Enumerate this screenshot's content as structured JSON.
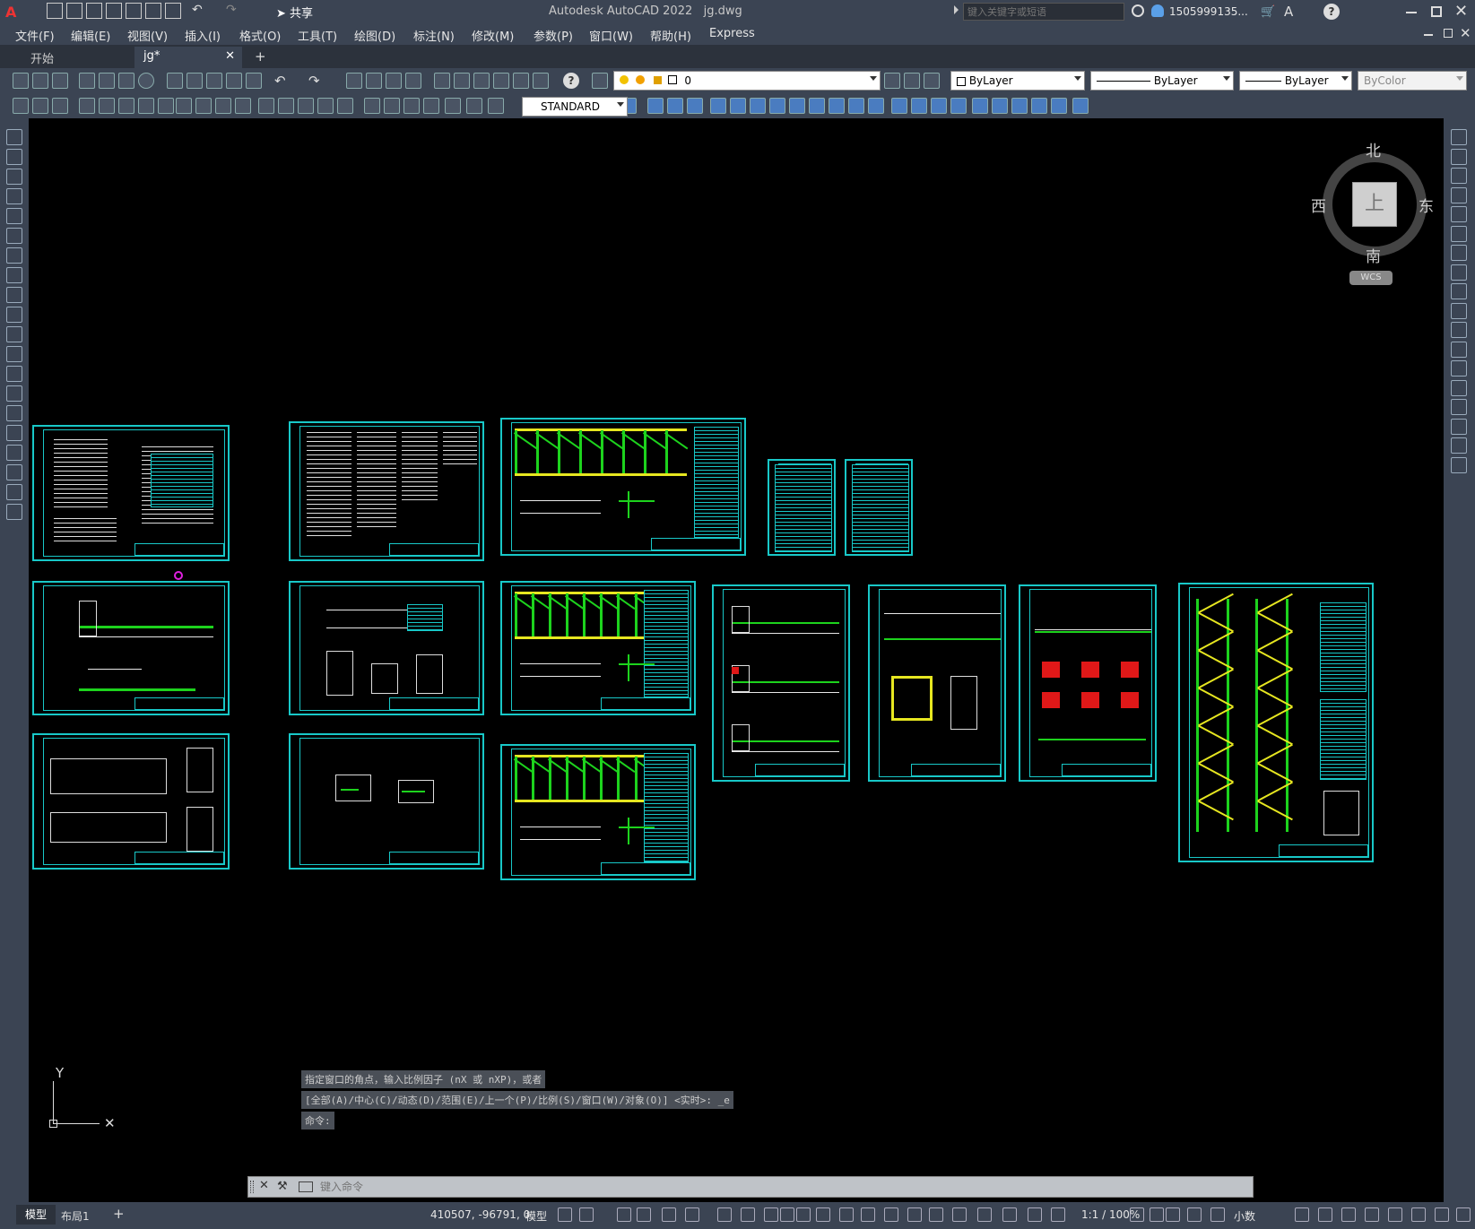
{
  "titlebar": {
    "app_title": "Autodesk AutoCAD 2022",
    "file_name": "jg.dwg",
    "share_label": "共享",
    "search_placeholder": "键入关键字或短语",
    "user_name": "1505999135...",
    "window_controls": [
      "minimize-icon",
      "maximize-icon",
      "close-icon"
    ]
  },
  "menu": {
    "items": [
      "文件(F)",
      "编辑(E)",
      "视图(V)",
      "插入(I)",
      "格式(O)",
      "工具(T)",
      "绘图(D)",
      "标注(N)",
      "修改(M)",
      "参数(P)",
      "窗口(W)",
      "帮助(H)",
      "Express"
    ]
  },
  "tabs": {
    "items": [
      {
        "label": "开始"
      },
      {
        "label": "jg*"
      }
    ],
    "add_label": "+"
  },
  "layers": {
    "current_layer": "0",
    "color": "ByLayer",
    "linetype": "ByLayer",
    "lineweight": "ByLayer",
    "plotstyle": "ByColor",
    "textstyle": "STANDARD"
  },
  "viewcube": {
    "north": "北",
    "south": "南",
    "east": "东",
    "west": "西",
    "top": "上",
    "wcs": "WCS"
  },
  "ucs": {
    "y_label": "Y"
  },
  "command": {
    "history": [
      "指定窗口的角点，输入比例因子 (nX 或 nXP)，或者",
      "[全部(A)/中心(C)/动态(D)/范围(E)/上一个(P)/比例(S)/窗口(W)/对象(O)] <实时>: _e",
      "命令:"
    ],
    "placeholder": "键入命令"
  },
  "status": {
    "layout_tabs": [
      "模型",
      "布局1"
    ],
    "add_label": "+",
    "coords": "410507, -96791, 0",
    "model_label": "模型",
    "scale": "1:1 / 100%",
    "units": "小数"
  },
  "colors": {
    "accent": "#18c8c8",
    "chrome": "#3b4453",
    "canvas": "#000000",
    "line_green": "#1dd31d",
    "line_yellow": "#e6e620"
  }
}
